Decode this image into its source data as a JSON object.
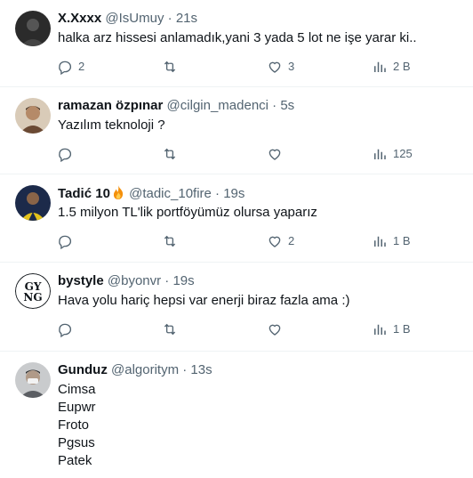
{
  "tweets": [
    {
      "name": "X.Xxxx",
      "handle": "@IsUmuy",
      "separator": "·",
      "time": "21s",
      "text": "halka arz hissesi anlamadık,yani 3 yada 5 lot ne işe yarar ki..",
      "replies": "2",
      "retweets": "",
      "likes": "3",
      "views": "2 B",
      "avatar_color": "#2b2b2b"
    },
    {
      "name": "ramazan özpınar",
      "handle": "@cilgin_madenci",
      "separator": "·",
      "time": "5s",
      "text": "Yazılım teknoloji ?",
      "replies": "",
      "retweets": "",
      "likes": "",
      "views": "125",
      "avatar_color": "#7a5a40"
    },
    {
      "name": "Tadić 10",
      "handle": "@tadic_10fire",
      "separator": "·",
      "time": "19s",
      "text": "1.5 milyon TL'lik portföyümüz olursa yaparız",
      "replies": "",
      "retweets": "",
      "likes": "2",
      "views": "1 B",
      "avatar_color": "#1c2a4a"
    },
    {
      "name": "bystyle",
      "handle": "@byonvr",
      "separator": "·",
      "time": "19s",
      "text": "Hava yolu hariç hepsi var enerji biraz fazla ama :)",
      "replies": "",
      "retweets": "",
      "likes": "",
      "views": "1 B",
      "avatar_text": "GY NG"
    },
    {
      "name": "Gunduz",
      "handle": "@algoritym",
      "separator": "·",
      "time": "13s",
      "lines": [
        "Cimsa",
        "Eupwr",
        "Froto",
        "Pgsus",
        "Patek"
      ],
      "avatar_color": "#8d8f92"
    }
  ],
  "colors": {
    "text_primary": "#0f1419",
    "text_secondary": "#536471",
    "divider": "#eff3f4"
  },
  "icons": [
    "reply-icon",
    "retweet-icon",
    "like-icon",
    "views-icon",
    "fire-icon"
  ]
}
